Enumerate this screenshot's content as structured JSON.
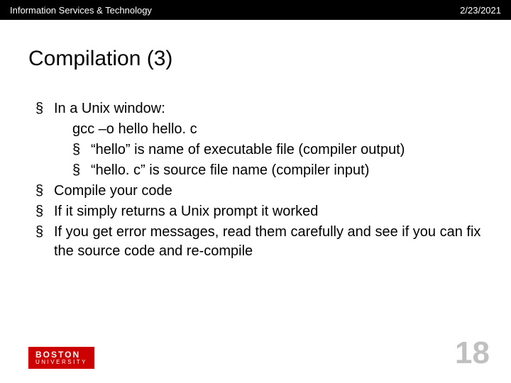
{
  "header": {
    "left": "Information Services & Technology",
    "right": "2/23/2021"
  },
  "title": "Compilation (3)",
  "bullets": {
    "l1_0": "In a Unix window:",
    "cmd": "gcc  –o  hello  hello. c",
    "l2_0": "“hello” is name of executable file (compiler output)",
    "l2_1": "“hello. c” is source file name (compiler input)",
    "l1_1": "Compile your code",
    "l1_2": "If it simply returns a Unix prompt it worked",
    "l1_3": "If you get error messages, read them carefully and see if you can fix the source code and re-compile"
  },
  "logo": {
    "line1": "BOSTON",
    "line2": "UNIVERSITY"
  },
  "page_number": "18",
  "bullet_glyph": "§"
}
